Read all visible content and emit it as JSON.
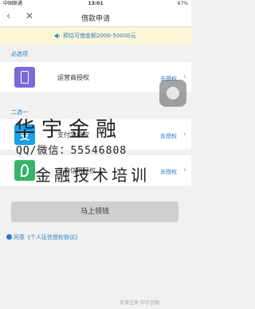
{
  "status_bar": {
    "carrier": "中国联通",
    "time": "13:01",
    "battery": "67%"
  },
  "nav": {
    "title": "借款申请"
  },
  "notice": {
    "text": "预估可借金额2000-50000元"
  },
  "required_section": {
    "label": "必选项",
    "items": [
      {
        "label": "运营商授权",
        "action": "去授权"
      }
    ]
  },
  "optional_section": {
    "label": "二选一",
    "items": [
      {
        "label": "支付宝授权",
        "action": "去授权"
      },
      {
        "label": "芝麻信用授权",
        "action": "去授权"
      }
    ]
  },
  "submit_button": {
    "label": "马上领钱"
  },
  "agreement": {
    "prefix": "同意",
    "link": "《个人征信授权协议》"
  },
  "watermark": {
    "line1": "华宇金融",
    "line2": "QQ/微信：55546808",
    "line3": "金融技术培训",
    "corner": "天津注册    中宇金融"
  },
  "colors": {
    "accent": "#2a7bc9",
    "notice_bg": "#fdf6d6",
    "operator_icon": "#7a6ad8",
    "alipay_icon": "#18a0e8",
    "zhima_icon": "#39b36b"
  }
}
